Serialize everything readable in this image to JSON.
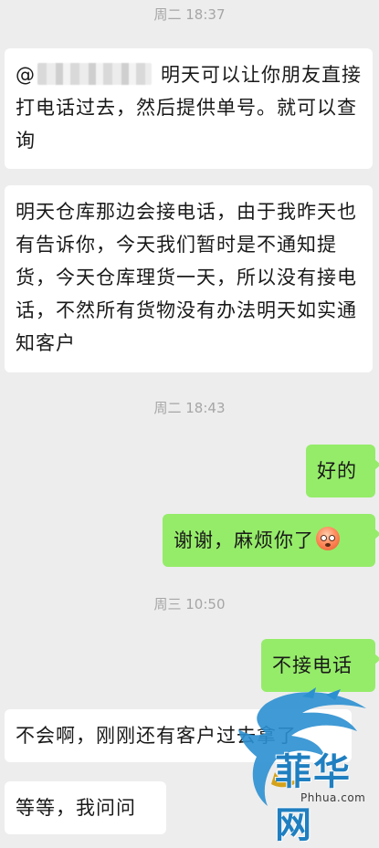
{
  "messages": [
    {
      "type": "timestamp",
      "text": "周二 18:37"
    },
    {
      "type": "incoming",
      "prefix": "@",
      "text": "明天可以让你朋友直接打电话过去，然后提供单号。就可以查询"
    },
    {
      "type": "incoming",
      "text": "明天仓库那边会接电话，由于我昨天也有告诉你，今天我们暂时是不通知提货，今天仓库理货一天，所以没有接电话，不然所有货物没有办法明天如实通知客户"
    },
    {
      "type": "timestamp",
      "text": "周二 18:43"
    },
    {
      "type": "outgoing",
      "text": "好的"
    },
    {
      "type": "outgoing",
      "text": "谢谢，麻烦你了",
      "emoji": "flushed-face-icon"
    },
    {
      "type": "timestamp",
      "text": "周三 10:50"
    },
    {
      "type": "outgoing",
      "text": "不接电话"
    },
    {
      "type": "incoming",
      "text": "不会啊，刚刚还有客户过去拿了"
    },
    {
      "type": "incoming",
      "text": "等等，我问问"
    }
  ],
  "watermark": {
    "title": "菲华网",
    "url": "Phhua.com"
  },
  "colors": {
    "background": "#ededed",
    "incoming_bubble": "#ffffff",
    "outgoing_bubble": "#95ec69",
    "timestamp_text": "#a6a6a6",
    "message_text": "#191919",
    "watermark_blue": "#1f7fc0"
  }
}
